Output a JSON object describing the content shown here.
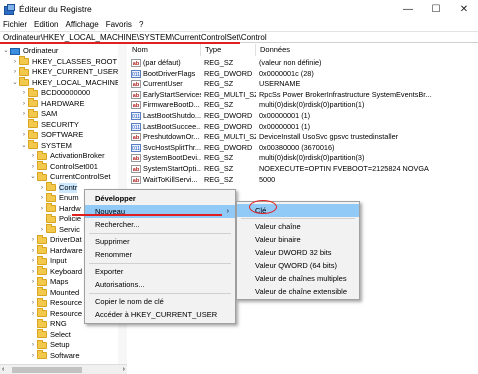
{
  "window": {
    "title": "Éditeur du Registre",
    "controls": [
      "—",
      "☐",
      "✕"
    ]
  },
  "menubar": [
    "Fichier",
    "Edition",
    "Affichage",
    "Favoris",
    "?"
  ],
  "address": "Ordinateur\\HKEY_LOCAL_MACHINE\\SYSTEM\\CurrentControlSet\\Control",
  "tree": [
    {
      "label": "Ordinateur",
      "indent": 0,
      "chev": "⌄",
      "icon": "pc"
    },
    {
      "label": "HKEY_CLASSES_ROOT",
      "indent": 1,
      "chev": "›",
      "icon": "folder"
    },
    {
      "label": "HKEY_CURRENT_USER",
      "indent": 1,
      "chev": "›",
      "icon": "folder"
    },
    {
      "label": "HKEY_LOCAL_MACHINE",
      "indent": 1,
      "chev": "⌄",
      "icon": "folder"
    },
    {
      "label": "BCD00000000",
      "indent": 2,
      "chev": "›",
      "icon": "folder"
    },
    {
      "label": "HARDWARE",
      "indent": 2,
      "chev": "›",
      "icon": "folder"
    },
    {
      "label": "SAM",
      "indent": 2,
      "chev": "›",
      "icon": "folder"
    },
    {
      "label": "SECURITY",
      "indent": 2,
      "chev": "",
      "icon": "folder"
    },
    {
      "label": "SOFTWARE",
      "indent": 2,
      "chev": "›",
      "icon": "folder"
    },
    {
      "label": "SYSTEM",
      "indent": 2,
      "chev": "⌄",
      "icon": "folder"
    },
    {
      "label": "ActivationBroker",
      "indent": 3,
      "chev": "›",
      "icon": "folder"
    },
    {
      "label": "ControlSet001",
      "indent": 3,
      "chev": "›",
      "icon": "folder"
    },
    {
      "label": "CurrentControlSet",
      "indent": 3,
      "chev": "⌄",
      "icon": "folder"
    },
    {
      "label": "Contr",
      "indent": 4,
      "chev": "›",
      "icon": "folder",
      "selected": true
    },
    {
      "label": "Enum",
      "indent": 4,
      "chev": "›",
      "icon": "folder"
    },
    {
      "label": "Hardw",
      "indent": 4,
      "chev": "›",
      "icon": "folder"
    },
    {
      "label": "Policie",
      "indent": 4,
      "chev": "",
      "icon": "folder"
    },
    {
      "label": "Servic",
      "indent": 4,
      "chev": "›",
      "icon": "folder"
    },
    {
      "label": "DriverDat",
      "indent": 3,
      "chev": "›",
      "icon": "folder"
    },
    {
      "label": "Hardware",
      "indent": 3,
      "chev": "›",
      "icon": "folder"
    },
    {
      "label": "Input",
      "indent": 3,
      "chev": "›",
      "icon": "folder"
    },
    {
      "label": "Keyboard",
      "indent": 3,
      "chev": "›",
      "icon": "folder"
    },
    {
      "label": "Maps",
      "indent": 3,
      "chev": "›",
      "icon": "folder"
    },
    {
      "label": "Mounted",
      "indent": 3,
      "chev": "",
      "icon": "folder"
    },
    {
      "label": "Resource",
      "indent": 3,
      "chev": "›",
      "icon": "folder"
    },
    {
      "label": "Resource",
      "indent": 3,
      "chev": "›",
      "icon": "folder"
    },
    {
      "label": "RNG",
      "indent": 3,
      "chev": "",
      "icon": "folder"
    },
    {
      "label": "Select",
      "indent": 3,
      "chev": "",
      "icon": "folder"
    },
    {
      "label": "Setup",
      "indent": 3,
      "chev": "›",
      "icon": "folder"
    },
    {
      "label": "Software",
      "indent": 3,
      "chev": "›",
      "icon": "folder"
    }
  ],
  "list": {
    "headers": [
      "Nom",
      "Type",
      "Données"
    ],
    "rows": [
      {
        "icon": "ab",
        "name": "(par défaut)",
        "type": "REG_SZ",
        "data": "(valeur non définie)"
      },
      {
        "icon": "bin",
        "name": "BootDriverFlags",
        "type": "REG_DWORD",
        "data": "0x0000001c (28)"
      },
      {
        "icon": "ab",
        "name": "CurrentUser",
        "type": "REG_SZ",
        "data": "USERNAME"
      },
      {
        "icon": "ab",
        "name": "EarlyStartServices",
        "type": "REG_MULTI_SZ",
        "data": "RpcSs Power BrokerInfrastructure SystemEventsBr..."
      },
      {
        "icon": "ab",
        "name": "FirmwareBootD...",
        "type": "REG_SZ",
        "data": "multi(0)disk(0)rdisk(0)partition(1)"
      },
      {
        "icon": "bin",
        "name": "LastBootShutdo...",
        "type": "REG_DWORD",
        "data": "0x00000001 (1)"
      },
      {
        "icon": "bin",
        "name": "LastBootSuccee...",
        "type": "REG_DWORD",
        "data": "0x00000001 (1)"
      },
      {
        "icon": "ab",
        "name": "PreshutdownOr...",
        "type": "REG_MULTI_SZ",
        "data": "DeviceInstall UsoSvc gpsvc trustedinstaller"
      },
      {
        "icon": "bin",
        "name": "SvcHostSplitThr...",
        "type": "REG_DWORD",
        "data": "0x00380000 (3670016)"
      },
      {
        "icon": "ab",
        "name": "SystemBootDevi...",
        "type": "REG_SZ",
        "data": "multi(0)disk(0)rdisk(0)partition(3)"
      },
      {
        "icon": "ab",
        "name": "SystemStartOpti...",
        "type": "REG_SZ",
        "data": "NOEXECUTE=OPTIN  FVEBOOT=2125824  NOVGA"
      },
      {
        "icon": "ab",
        "name": "WaitToKillServi...",
        "type": "REG_SZ",
        "data": "5000"
      }
    ]
  },
  "context_menu": {
    "items": [
      "Développer",
      "Nouveau",
      "Rechercher...",
      "Supprimer",
      "Renommer",
      "Exporter",
      "Autorisations...",
      "Copier le nom de clé",
      "Accéder à HKEY_CURRENT_USER"
    ],
    "arrow": "›"
  },
  "submenu": {
    "items": [
      "Clé",
      "Valeur chaîne",
      "Valeur binaire",
      "Valeur DWORD 32 bits",
      "Valeur QWORD (64 bits)",
      "Valeur de chaînes multiples",
      "Valeur de chaîne extensible"
    ]
  },
  "colors": {
    "highlight": "#91c9f7",
    "annotation": "#e02020",
    "selection": "#cce8ff"
  }
}
